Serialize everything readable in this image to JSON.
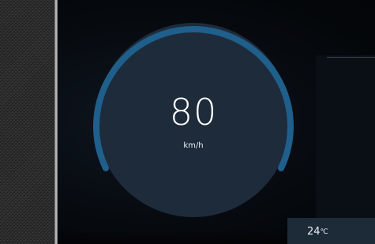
{
  "speedometer": {
    "speed": "80",
    "unit": "km/h",
    "arc_color": "#1f5f8b",
    "face_color": "#1e2b3b"
  },
  "climate": {
    "temperature": "24",
    "unit": "℃"
  },
  "icons": {
    "gauge": "speedometer-gauge-icon"
  }
}
